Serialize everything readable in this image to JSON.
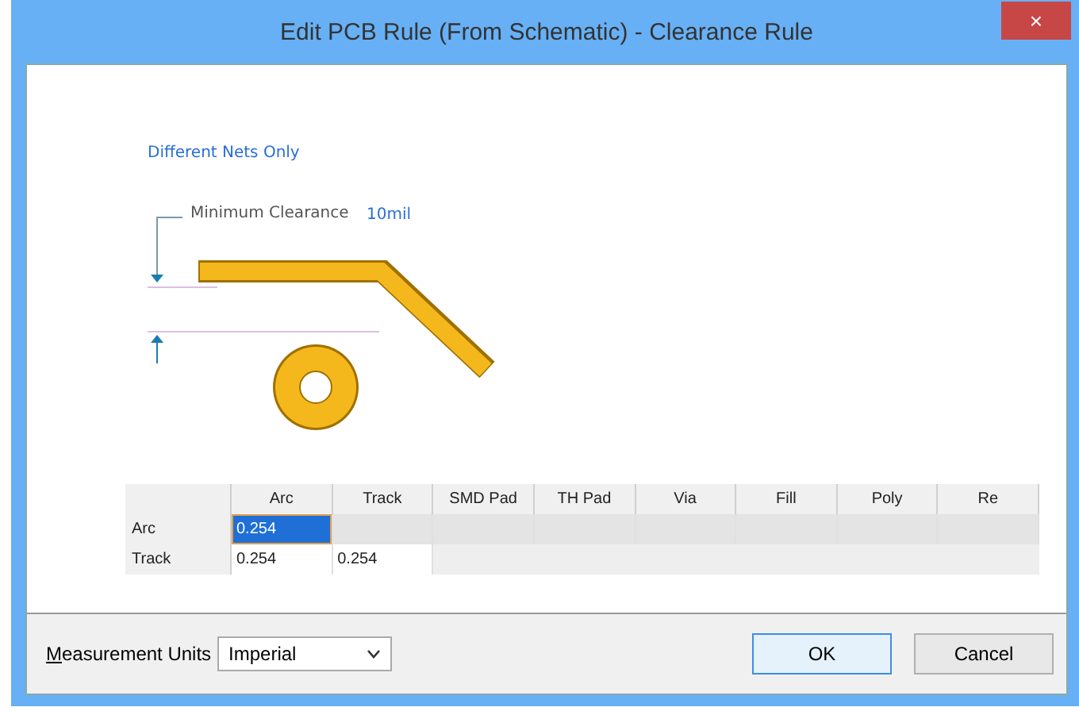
{
  "window": {
    "title": "Edit PCB Rule (From Schematic) - Clearance Rule",
    "close": "×"
  },
  "diagram": {
    "scope": "Different Nets Only",
    "label": "Minimum Clearance",
    "value": "10mil"
  },
  "table": {
    "columns": [
      "Arc",
      "Track",
      "SMD Pad",
      "TH Pad",
      "Via",
      "Fill",
      "Poly",
      "Re"
    ],
    "rows": [
      {
        "header": "Arc",
        "cells": [
          {
            "value": "0.254",
            "selected": true
          }
        ]
      },
      {
        "header": "Track",
        "cells": [
          {
            "value": "0.254",
            "selected": false
          },
          {
            "value": "0.254",
            "selected": false
          }
        ]
      }
    ]
  },
  "footer": {
    "units_label": "Measurement Units",
    "units_value": "Imperial",
    "buttons": [
      {
        "label": "OK",
        "focused": true
      },
      {
        "label": "Cancel",
        "focused": false
      }
    ]
  }
}
